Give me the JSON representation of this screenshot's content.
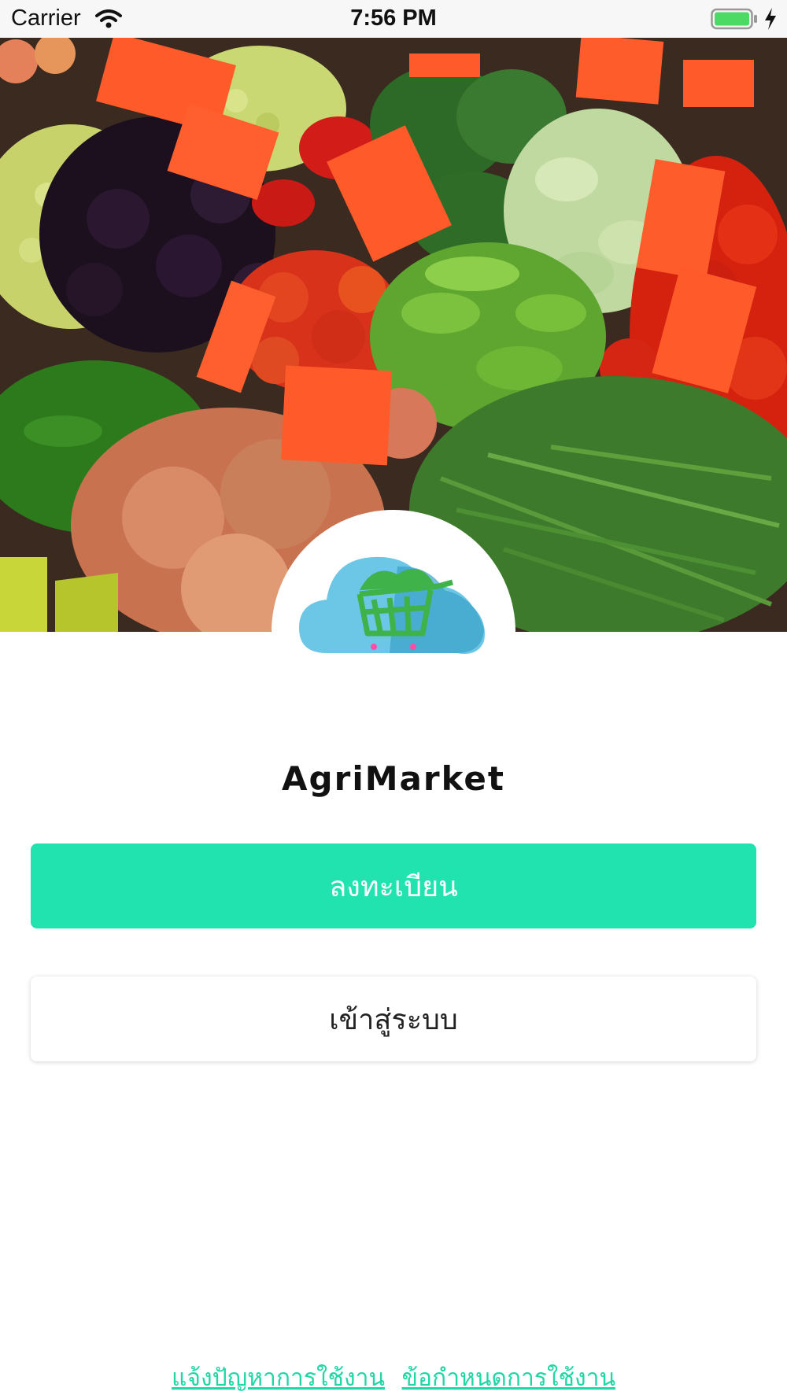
{
  "status_bar": {
    "carrier": "Carrier",
    "time": "7:56 PM",
    "icons": [
      "wifi-icon",
      "battery-icon",
      "charging-bolt-icon"
    ]
  },
  "hero": {
    "image": "market-produce-photo"
  },
  "logo": {
    "icon": "cloud-cart-logo-icon"
  },
  "app_name": "AgriMarket",
  "buttons": {
    "register": "ลงทะเบียน",
    "login": "เข้าสู่ระบบ"
  },
  "footer": {
    "report_problem": "แจ้งปัญหาการใช้งาน",
    "terms": "ข้อกำหนดการใช้งาน"
  },
  "colors": {
    "accent": "#21e3b0",
    "link": "#21d6a5",
    "logo_cloud": "#6cc6e6",
    "logo_cart": "#3fb24a"
  }
}
